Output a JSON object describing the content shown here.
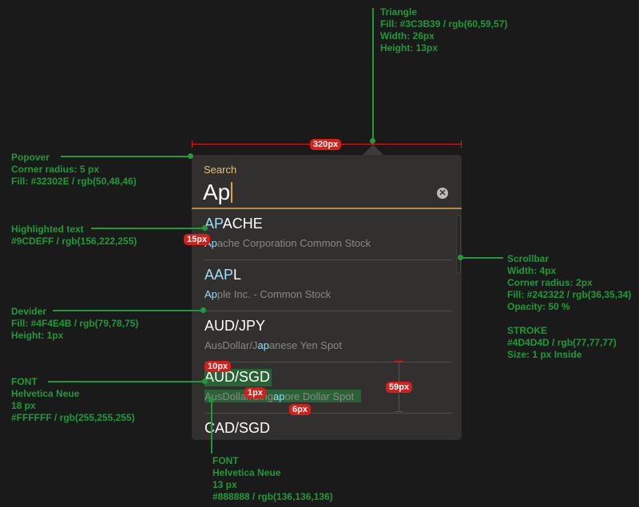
{
  "search": {
    "label": "Search",
    "value": "Ap"
  },
  "results": [
    {
      "symbol_hl": "AP",
      "symbol_rest": "ACHE",
      "desc_pre": "",
      "desc_hl": "Ap",
      "desc_rest": "ache Corporation Common Stock"
    },
    {
      "symbol_hl": "AAP",
      "symbol_rest": "L",
      "desc_pre": "",
      "desc_hl": "Ap",
      "desc_rest": "ple Inc. - Common Stock"
    },
    {
      "symbol_hl": "",
      "symbol_rest": "AUD/JPY",
      "desc_pre": "AusDollar/J",
      "desc_hl": "ap",
      "desc_rest": "anese Yen Spot"
    },
    {
      "symbol_hl": "",
      "symbol_rest": "AUD/SGD",
      "desc_pre": "AusDollar/Sing",
      "desc_hl": "ap",
      "desc_rest": "ore Dollar Spot"
    },
    {
      "symbol_hl": "",
      "symbol_rest": "CAD/SGD",
      "desc_pre": "",
      "desc_hl": "",
      "desc_rest": ""
    }
  ],
  "annotations": {
    "triangle": [
      "Triangle",
      "Fill: #3C3B39 / rgb(60,59,57)",
      "Width: 26px",
      "Height: 13px"
    ],
    "popover": [
      "Popover",
      "Corner radius: 5 px",
      "Fill: #32302E / rgb(50,48,46)"
    ],
    "highlighted": [
      "Highlighted text",
      "#9CDEFF / rgb(156,222,255)"
    ],
    "divider": [
      "Devider",
      "Fill: #4F4E4B / rgb(79,78,75)",
      "Height: 1px"
    ],
    "font_main": [
      "FONT",
      "Helvetica Neue",
      "18 px",
      "#FFFFFF / rgb(255,255,255)"
    ],
    "font_sub": [
      "FONT",
      "Helvetica Neue",
      "13 px",
      "#888888 / rgb(136,136,136)"
    ],
    "scrollbar": [
      "Scrollbar",
      "Width: 4px",
      "Corner radius: 2px",
      "Fill: #242322 / rgb(36,35,34)",
      "Opacity: 50 %",
      "",
      "STROKE",
      "#4D4D4D / rgb(77,77,77)",
      "Size: 1 px Inside"
    ]
  },
  "measures": {
    "width_320": "320px",
    "pad_15": "15px",
    "gap_10": "10px",
    "gap_1": "1px",
    "gap_6": "6px",
    "row_59": "59px"
  },
  "colors": {
    "popover": "#32302E",
    "triangle": "#3C3B39",
    "highlight": "#9CDEFF",
    "divider": "#4F4E4B",
    "annotation": "#1F9A3A",
    "measure": "#D2201C"
  }
}
